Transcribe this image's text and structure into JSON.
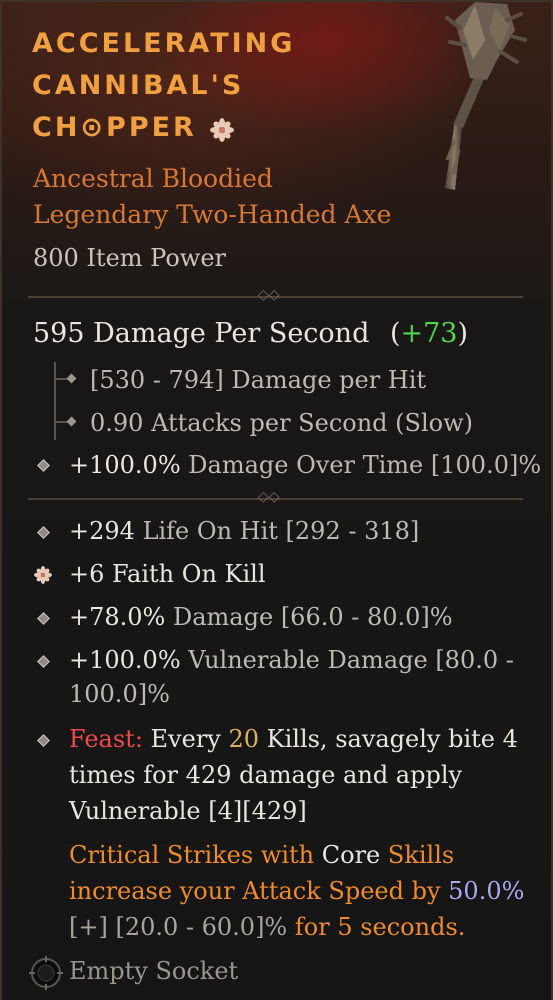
{
  "item": {
    "title_lines": [
      "ACCELERATING",
      "CANNIBAL'S",
      "CH⊙PPER"
    ],
    "subtitle_1": "Ancestral Bloodied",
    "subtitle_2": "Legendary Two-Handed Axe",
    "item_power": "800 Item Power"
  },
  "dps": {
    "label": "595 Damage Per Second",
    "delta_open": "(",
    "delta": "+73",
    "delta_close": ")"
  },
  "weapon_stats": {
    "damage_per_hit": "[530 - 794] Damage per Hit",
    "attacks_per_second": "0.90 Attacks per Second (Slow)",
    "implicit_value": "+100.0%",
    "implicit_text": "Damage Over Time [100.0]%"
  },
  "affixes": [
    {
      "value": "+294",
      "text": "Life On Hit [292 - 318]"
    },
    {
      "value": "+6",
      "text": "Faith On Kill"
    },
    {
      "value": "+78.0%",
      "text": "Damage [66.0 - 80.0]%"
    },
    {
      "value": "+100.0%",
      "text": "Vulnerable Damage [80.0 -",
      "text2": "100.0]%"
    }
  ],
  "feast": {
    "label": "Feast:",
    "t1": " Every ",
    "n1": "20",
    "t2": " Kills, savagely bite ",
    "n2": "4",
    "line2a": "times for ",
    "n3": "429",
    "line2b": " damage and apply",
    "line3": "Vulnerable [4][429]"
  },
  "legendary": {
    "l1a": "Critical Strikes with ",
    "l1b": "Core",
    "l1c": " Skills",
    "l2a": "increase your Attack Speed by ",
    "l2b": "50.0%",
    "l3a": "[+] [20.0 - 60.0]%",
    "l3b": " for 5 seconds."
  },
  "socket": {
    "label": "Empty Socket"
  },
  "icons": [
    "faith-flower-icon",
    "socket-icon",
    "axe-weapon-icon",
    "diamond-bullet-icon"
  ],
  "colors": {
    "title": "#f0a040",
    "subtitle": "#d77834",
    "upgrade_green": "#4fd64a",
    "feast_red": "#ee4a4a",
    "number_gold": "#dcb25c",
    "value_blue": "#a9a8f0",
    "legendary_orange": "#ef8b2a"
  }
}
